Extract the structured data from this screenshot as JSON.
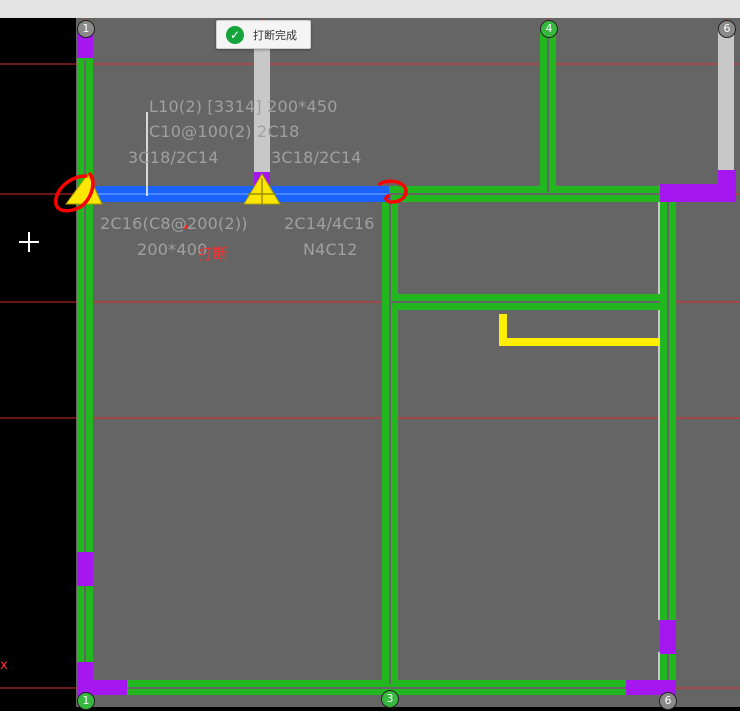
{
  "toast": {
    "message": "打断完成",
    "icon": "check-circle-icon"
  },
  "beam_label": {
    "line1": "L10(2) [3314] 200*450",
    "line2": "C10@100(2) 2C18",
    "line3": "3C18/2C14",
    "line4": "3C18/2C14",
    "line5": "2C16(C8@200(2))",
    "line6": "2C14/4C16",
    "line7": "200*400",
    "line8": "N4C12"
  },
  "break_label": "打断",
  "axis_labels": {
    "a1_top": "1",
    "a4_top": "4",
    "a6_top": "6",
    "a1_bottom": "1",
    "a3_bottom": "3",
    "a6_bottom": "6"
  },
  "side_marker": "x",
  "colors": {
    "background": "#656565",
    "left_panel": "#000000",
    "wall": "#22b61f",
    "beam_selected": "#1a63ff",
    "column": "#a516f0",
    "grid_line": "#e03030",
    "annotation_yellow": "#ffee00",
    "mark_red": "#ff0000"
  }
}
